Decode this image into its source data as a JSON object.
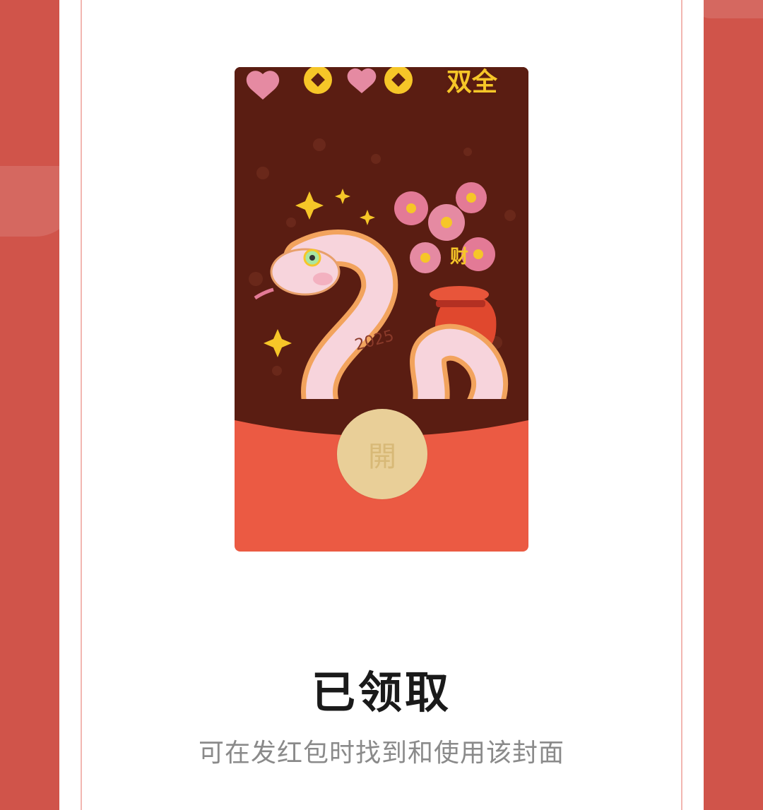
{
  "envelope": {
    "banner_line1": "财爱",
    "banner_line2": "双全",
    "bag_char": "财",
    "year": "2025",
    "open_label": "開"
  },
  "status": {
    "title": "已领取",
    "subtitle": "可在发红包时找到和使用该封面"
  },
  "colors": {
    "background": "#d0544a",
    "envelope_dark": "#5a1d12",
    "envelope_red": "#eb5a43",
    "open_button": "#e9cf98",
    "gold": "#f6c628"
  }
}
